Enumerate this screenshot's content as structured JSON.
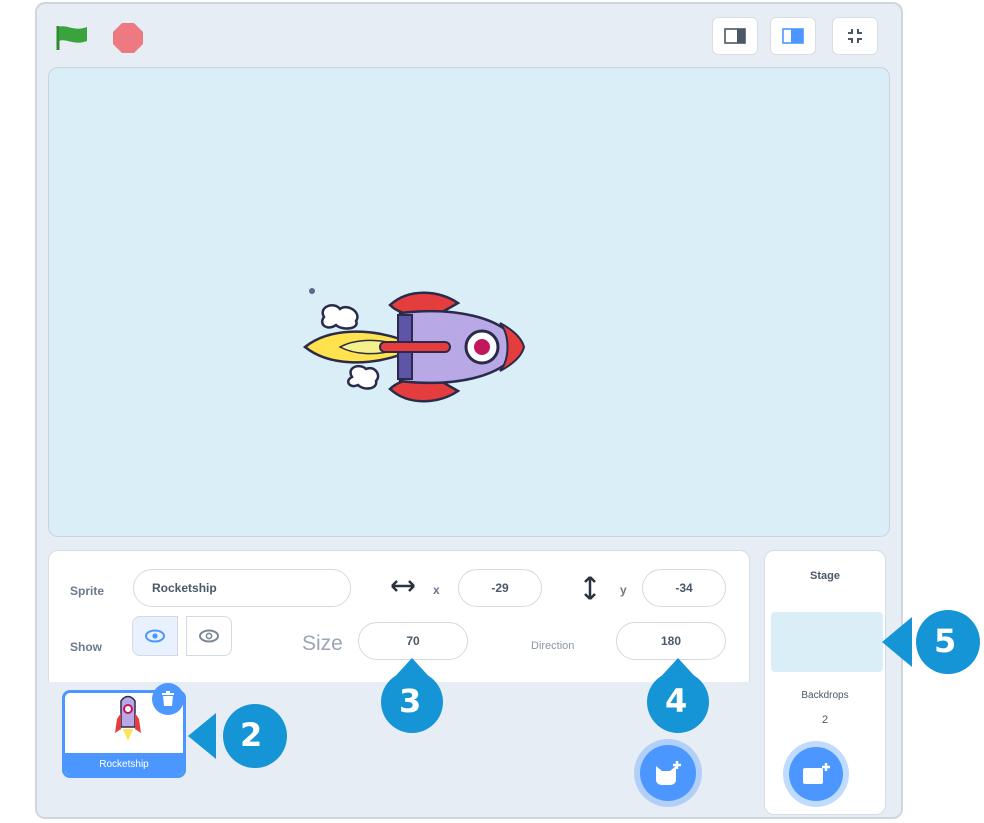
{
  "toolbar": {
    "green_flag": "green-flag-icon",
    "stop": "stop-icon",
    "small_stage_mode": "small-stage-icon",
    "normal_stage_mode": "normal-stage-icon",
    "fullscreen": "fullscreen-icon"
  },
  "stage": {
    "background": "#d9eef6",
    "sprite_name": "Rocketship"
  },
  "sprite_info": {
    "sprite_label": "Sprite",
    "sprite_name": "Rocketship",
    "x_label": "x",
    "x_value": "-29",
    "y_label": "y",
    "y_value": "-34",
    "show_label": "Show",
    "size_label": "Size",
    "size_value": "70",
    "direction_label": "Direction",
    "direction_value": "180"
  },
  "sprite_list": {
    "items": [
      {
        "name": "Rocketship"
      }
    ]
  },
  "stage_panel": {
    "title": "Stage",
    "backdrops_label": "Backdrops",
    "backdrops_count": "2"
  },
  "callouts": [
    "2",
    "3",
    "4",
    "5"
  ],
  "colors": {
    "accent": "#4c97ff",
    "callout": "#1594d6",
    "flag": "#3ba33b",
    "stop": "#ec7a80"
  }
}
